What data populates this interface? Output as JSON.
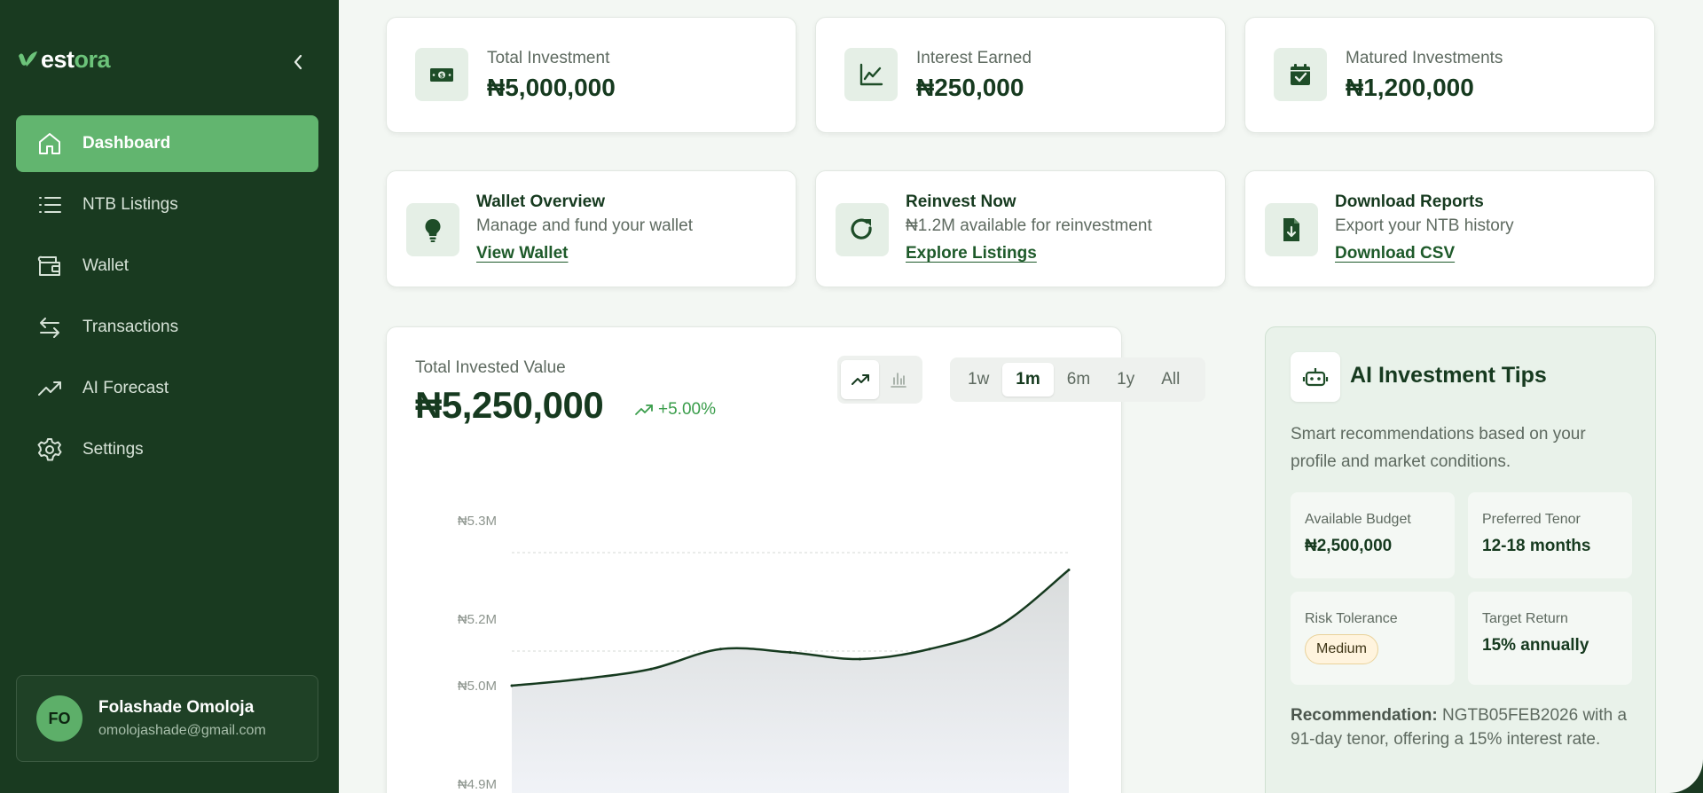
{
  "brand": {
    "logo_text_a": "est",
    "logo_text_b": "ora"
  },
  "sidebar": {
    "items": [
      {
        "label": "Dashboard",
        "icon": "home-icon",
        "active": true
      },
      {
        "label": "NTB Listings",
        "icon": "list-icon"
      },
      {
        "label": "Wallet",
        "icon": "wallet-icon"
      },
      {
        "label": "Transactions",
        "icon": "transfer-icon"
      },
      {
        "label": "AI Forecast",
        "icon": "trending-icon"
      },
      {
        "label": "Settings",
        "icon": "gear-icon"
      }
    ],
    "profile": {
      "initials": "FO",
      "name": "Folashade Omoloja",
      "email": "omolojashade@gmail.com"
    }
  },
  "stats": [
    {
      "label": "Total Investment",
      "value": "₦5,000,000",
      "icon": "cash-icon"
    },
    {
      "label": "Interest Earned",
      "value": "₦250,000",
      "icon": "chart-line-icon"
    },
    {
      "label": "Matured Investments",
      "value": "₦1,200,000",
      "icon": "calendar-check-icon"
    }
  ],
  "actions": [
    {
      "title": "Wallet Overview",
      "desc": "Manage and fund your wallet",
      "link": "View Wallet",
      "icon": "lightbulb-icon"
    },
    {
      "title": "Reinvest Now",
      "desc": "₦1.2M available for reinvestment",
      "link": "Explore Listings",
      "icon": "refresh-icon"
    },
    {
      "title": "Download Reports",
      "desc": "Export your NTB history",
      "link": "Download CSV",
      "icon": "file-download-icon"
    }
  ],
  "chart_panel": {
    "label": "Total Invested Value",
    "value": "₦5,250,000",
    "change": "+5.00%",
    "ranges": [
      "1w",
      "1m",
      "6m",
      "1y",
      "All"
    ],
    "active_range": "1m"
  },
  "chart_data": {
    "type": "area",
    "title": "",
    "xlabel": "",
    "ylabel": "",
    "y_ticks": [
      "₦5.3M",
      "₦5.2M",
      "₦5.0M",
      "₦4.9M"
    ],
    "ylim": [
      4.9,
      5.3
    ],
    "series": [
      {
        "x": [
          0,
          1,
          2,
          3,
          4,
          5,
          6,
          7,
          8
        ],
        "values": [
          5.0,
          5.02,
          5.05,
          5.11,
          5.1,
          5.08,
          5.11,
          5.18,
          5.25
        ]
      }
    ],
    "grid": true,
    "colors": {
      "line": "#163a1f",
      "fill_top": "#d9dcdc",
      "fill_bottom": "#f4f6fb"
    }
  },
  "tips": {
    "title": "AI Investment Tips",
    "desc": "Smart recommendations based on your profile and market conditions.",
    "budget_label": "Available Budget",
    "budget_value": "₦2,500,000",
    "tenor_label": "Preferred Tenor",
    "tenor_value": "12-18 months",
    "risk_label": "Risk Tolerance",
    "risk_value": "Medium",
    "return_label": "Target Return",
    "return_value": "15% annually",
    "rec_label": "Recommendation:",
    "rec_text": "NGTB05FEB2026 with a 91-day tenor, offering a 15% interest rate."
  },
  "colors": {
    "sidebar_bg": "#193a20",
    "accent": "#62b56f",
    "brand_dark": "#163a1f",
    "positive": "#3a9d4b"
  }
}
